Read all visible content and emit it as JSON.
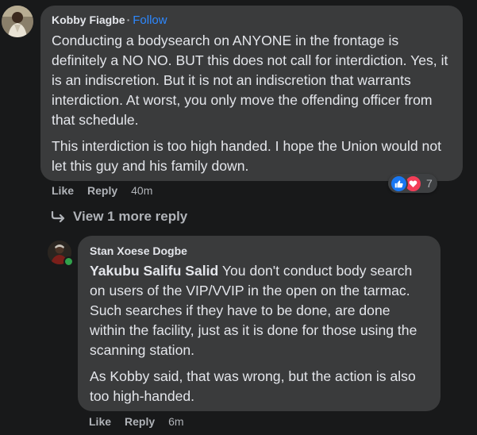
{
  "comment1": {
    "author": "Kobby Fiagbe",
    "separator": "·",
    "follow_label": "Follow",
    "paragraphs": [
      "Conducting a bodysearch on ANYONE in the frontage is definitely a NO NO. BUT this does not call for interdiction. Yes, it is an indiscretion. But it is not an indiscretion that warrants interdiction. At worst, you only move the offending officer from that schedule.",
      "This interdiction is too high handed. I hope the Union would not let this guy and his family down."
    ],
    "actions": {
      "like": "Like",
      "reply": "Reply",
      "time": "40m"
    },
    "reactions": {
      "count": "7",
      "icons": [
        "like-icon",
        "love-icon"
      ]
    }
  },
  "view_more": {
    "label": "View 1 more reply",
    "icon": "reply-arrow-icon"
  },
  "reply1": {
    "author": "Stan Xoese Dogbe",
    "mention": "Yakubu Salifu Salid",
    "first_paragraph_rest": " You don't conduct body search on users of the VIP/VVIP in the open on the tarmac. Such searches if they have to be done, are done within the facility, just as it is done for those using the scanning station.",
    "second_paragraph": "As Kobby said, that was wrong, but the action is also too high-handed.",
    "actions": {
      "like": "Like",
      "reply": "Reply",
      "time": "6m"
    },
    "online": true
  },
  "colors": {
    "background": "#18191a",
    "bubble": "#3a3b3c",
    "text": "#e4e6eb",
    "secondary": "#b0b3b8",
    "link": "#2d88ff",
    "like": "#1877f2",
    "love": "#f33e58",
    "online": "#31a24c"
  }
}
